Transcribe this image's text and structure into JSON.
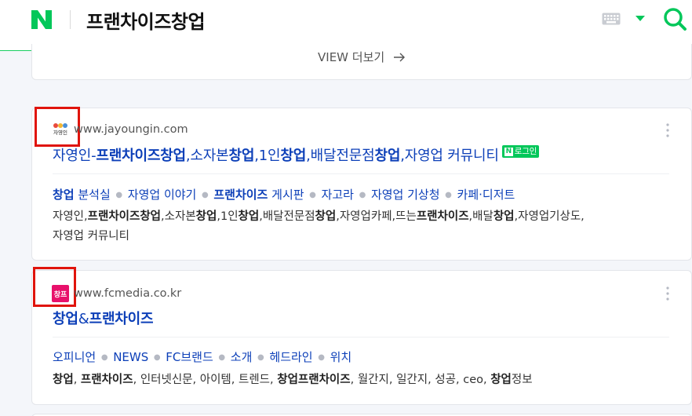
{
  "header": {
    "query": "프랜차이즈창업"
  },
  "icons": {
    "logo": "naver-n-logo",
    "keyboard": "keyboard-icon",
    "dropdown": "caret-down-icon",
    "search": "search-icon",
    "more": "more-vertical-icon",
    "view_more_arrow": "arrow-right-icon"
  },
  "colors": {
    "brand": "#03c75a",
    "link": "#0c3fb8",
    "highlight_box": "#e0140c"
  },
  "view_more": {
    "label": "VIEW 더보기"
  },
  "results": [
    {
      "favicon_text": "자영인",
      "site_url": "www.jayoungin.com",
      "title_parts": [
        {
          "text": "자영인-",
          "bold": false
        },
        {
          "text": "프랜차이즈창업",
          "bold": true
        },
        {
          "text": ",소자본",
          "bold": false
        },
        {
          "text": "창업",
          "bold": true
        },
        {
          "text": ",1인",
          "bold": false
        },
        {
          "text": "창업",
          "bold": true
        },
        {
          "text": ",배달전문점",
          "bold": false
        },
        {
          "text": "창업",
          "bold": true
        },
        {
          "text": ",자영업 커뮤니티",
          "bold": false
        }
      ],
      "login_badge": {
        "n": "N",
        "text": "로그인"
      },
      "sitelinks": [
        {
          "parts": [
            {
              "text": "창업",
              "bold": true
            },
            {
              "text": " 분석실",
              "bold": false
            }
          ]
        },
        {
          "parts": [
            {
              "text": "자영업 이야기",
              "bold": false
            }
          ]
        },
        {
          "parts": [
            {
              "text": "프랜차이즈",
              "bold": true
            },
            {
              "text": " 게시판",
              "bold": false
            }
          ]
        },
        {
          "parts": [
            {
              "text": "자고라",
              "bold": false
            }
          ]
        },
        {
          "parts": [
            {
              "text": "자영업 기상청",
              "bold": false
            }
          ]
        },
        {
          "parts": [
            {
              "text": "카페·디저트",
              "bold": false
            }
          ]
        }
      ],
      "desc_lines": [
        [
          {
            "text": "자영인,",
            "bold": false
          },
          {
            "text": "프랜차이즈창업",
            "bold": true
          },
          {
            "text": ",소자본",
            "bold": false
          },
          {
            "text": "창업",
            "bold": true
          },
          {
            "text": ",1인",
            "bold": false
          },
          {
            "text": "창업",
            "bold": true
          },
          {
            "text": ",배달전문점",
            "bold": false
          },
          {
            "text": "창업",
            "bold": true
          },
          {
            "text": ",자영업카페,뜨는",
            "bold": false
          },
          {
            "text": "프랜차이즈",
            "bold": true
          },
          {
            "text": ",배달",
            "bold": false
          },
          {
            "text": "창업",
            "bold": true
          },
          {
            "text": ",자영업기상도,",
            "bold": false
          }
        ],
        [
          {
            "text": "자영업 커뮤니티",
            "bold": false
          }
        ]
      ]
    },
    {
      "favicon_text": "창프",
      "site_url": "www.fcmedia.co.kr",
      "title_parts": [
        {
          "text": "창업",
          "bold": true
        },
        {
          "text": "&",
          "bold": false
        },
        {
          "text": "프랜차이즈",
          "bold": true
        }
      ],
      "sitelinks": [
        {
          "parts": [
            {
              "text": "오피니언",
              "bold": false
            }
          ]
        },
        {
          "parts": [
            {
              "text": "NEWS",
              "bold": false
            }
          ]
        },
        {
          "parts": [
            {
              "text": "FC브랜드",
              "bold": false
            }
          ]
        },
        {
          "parts": [
            {
              "text": "소개",
              "bold": false
            }
          ]
        },
        {
          "parts": [
            {
              "text": "헤드라인",
              "bold": false
            }
          ]
        },
        {
          "parts": [
            {
              "text": "위치",
              "bold": false
            }
          ]
        }
      ],
      "desc_lines": [
        [
          {
            "text": "창업",
            "bold": true
          },
          {
            "text": ", ",
            "bold": false
          },
          {
            "text": "프랜차이즈",
            "bold": true
          },
          {
            "text": ", 인터넷신문, 아이템, 트렌드, ",
            "bold": false
          },
          {
            "text": "창업프랜차이즈",
            "bold": true
          },
          {
            "text": ", 월간지, 일간지, 성공, ceo, ",
            "bold": false
          },
          {
            "text": "창업",
            "bold": true
          },
          {
            "text": "정보",
            "bold": false
          }
        ]
      ]
    }
  ]
}
